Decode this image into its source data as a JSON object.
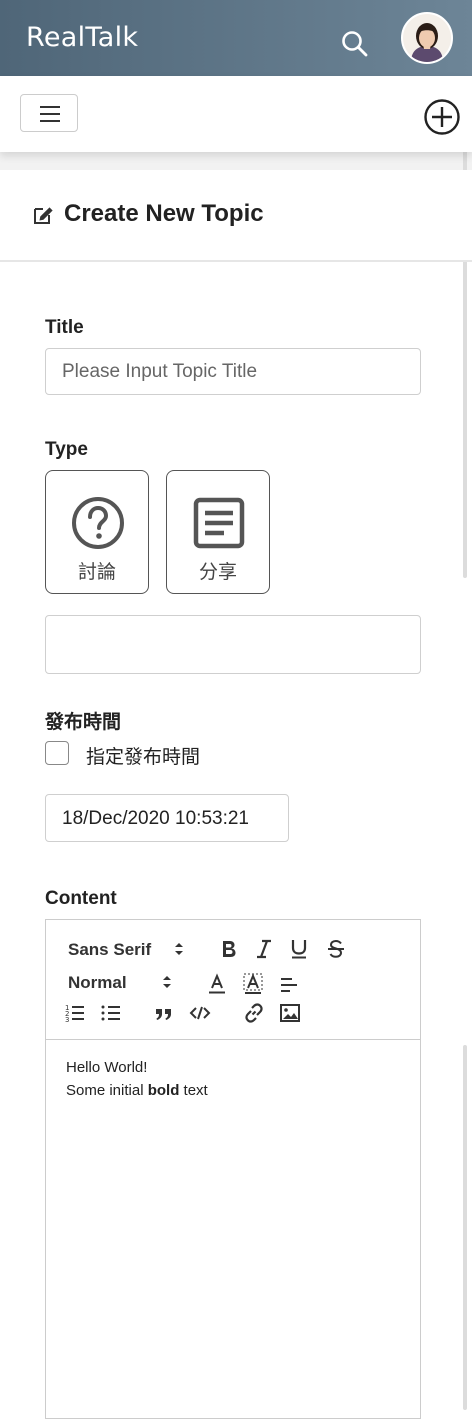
{
  "app": {
    "title": "RealTalk"
  },
  "header": {
    "search_icon": "search-icon",
    "avatar_alt": "user-avatar"
  },
  "toolbar": {
    "menu_icon": "hamburger-icon",
    "add_icon": "plus-circle-icon"
  },
  "page": {
    "title": "Create New Topic",
    "title_icon": "edit-icon"
  },
  "form": {
    "title_label": "Title",
    "title_placeholder": "Please Input Topic Title",
    "type_label": "Type",
    "types": [
      {
        "label": "討論",
        "icon": "question-circle-icon"
      },
      {
        "label": "分享",
        "icon": "article-icon"
      }
    ],
    "type_extra_value": "",
    "publish_label": "發布時間",
    "schedule_checkbox_label": "指定發布時間",
    "schedule_checked": false,
    "datetime_value": "18/Dec/2020 10:53:21",
    "content_label": "Content"
  },
  "editor": {
    "font_select": "Sans Serif",
    "size_select": "Normal",
    "tools": [
      "bold-icon",
      "italic-icon",
      "underline-icon",
      "strike-icon",
      "text-color-icon",
      "background-color-icon",
      "align-icon",
      "ordered-list-icon",
      "bullet-list-icon",
      "blockquote-icon",
      "code-icon",
      "link-icon",
      "image-icon"
    ],
    "content_line1": "Hello World!",
    "content_line2_prefix": "Some initial ",
    "content_line2_bold": "bold",
    "content_line2_suffix": " text"
  },
  "colors": {
    "appbar": "#5b7284",
    "border": "#cccccc"
  }
}
